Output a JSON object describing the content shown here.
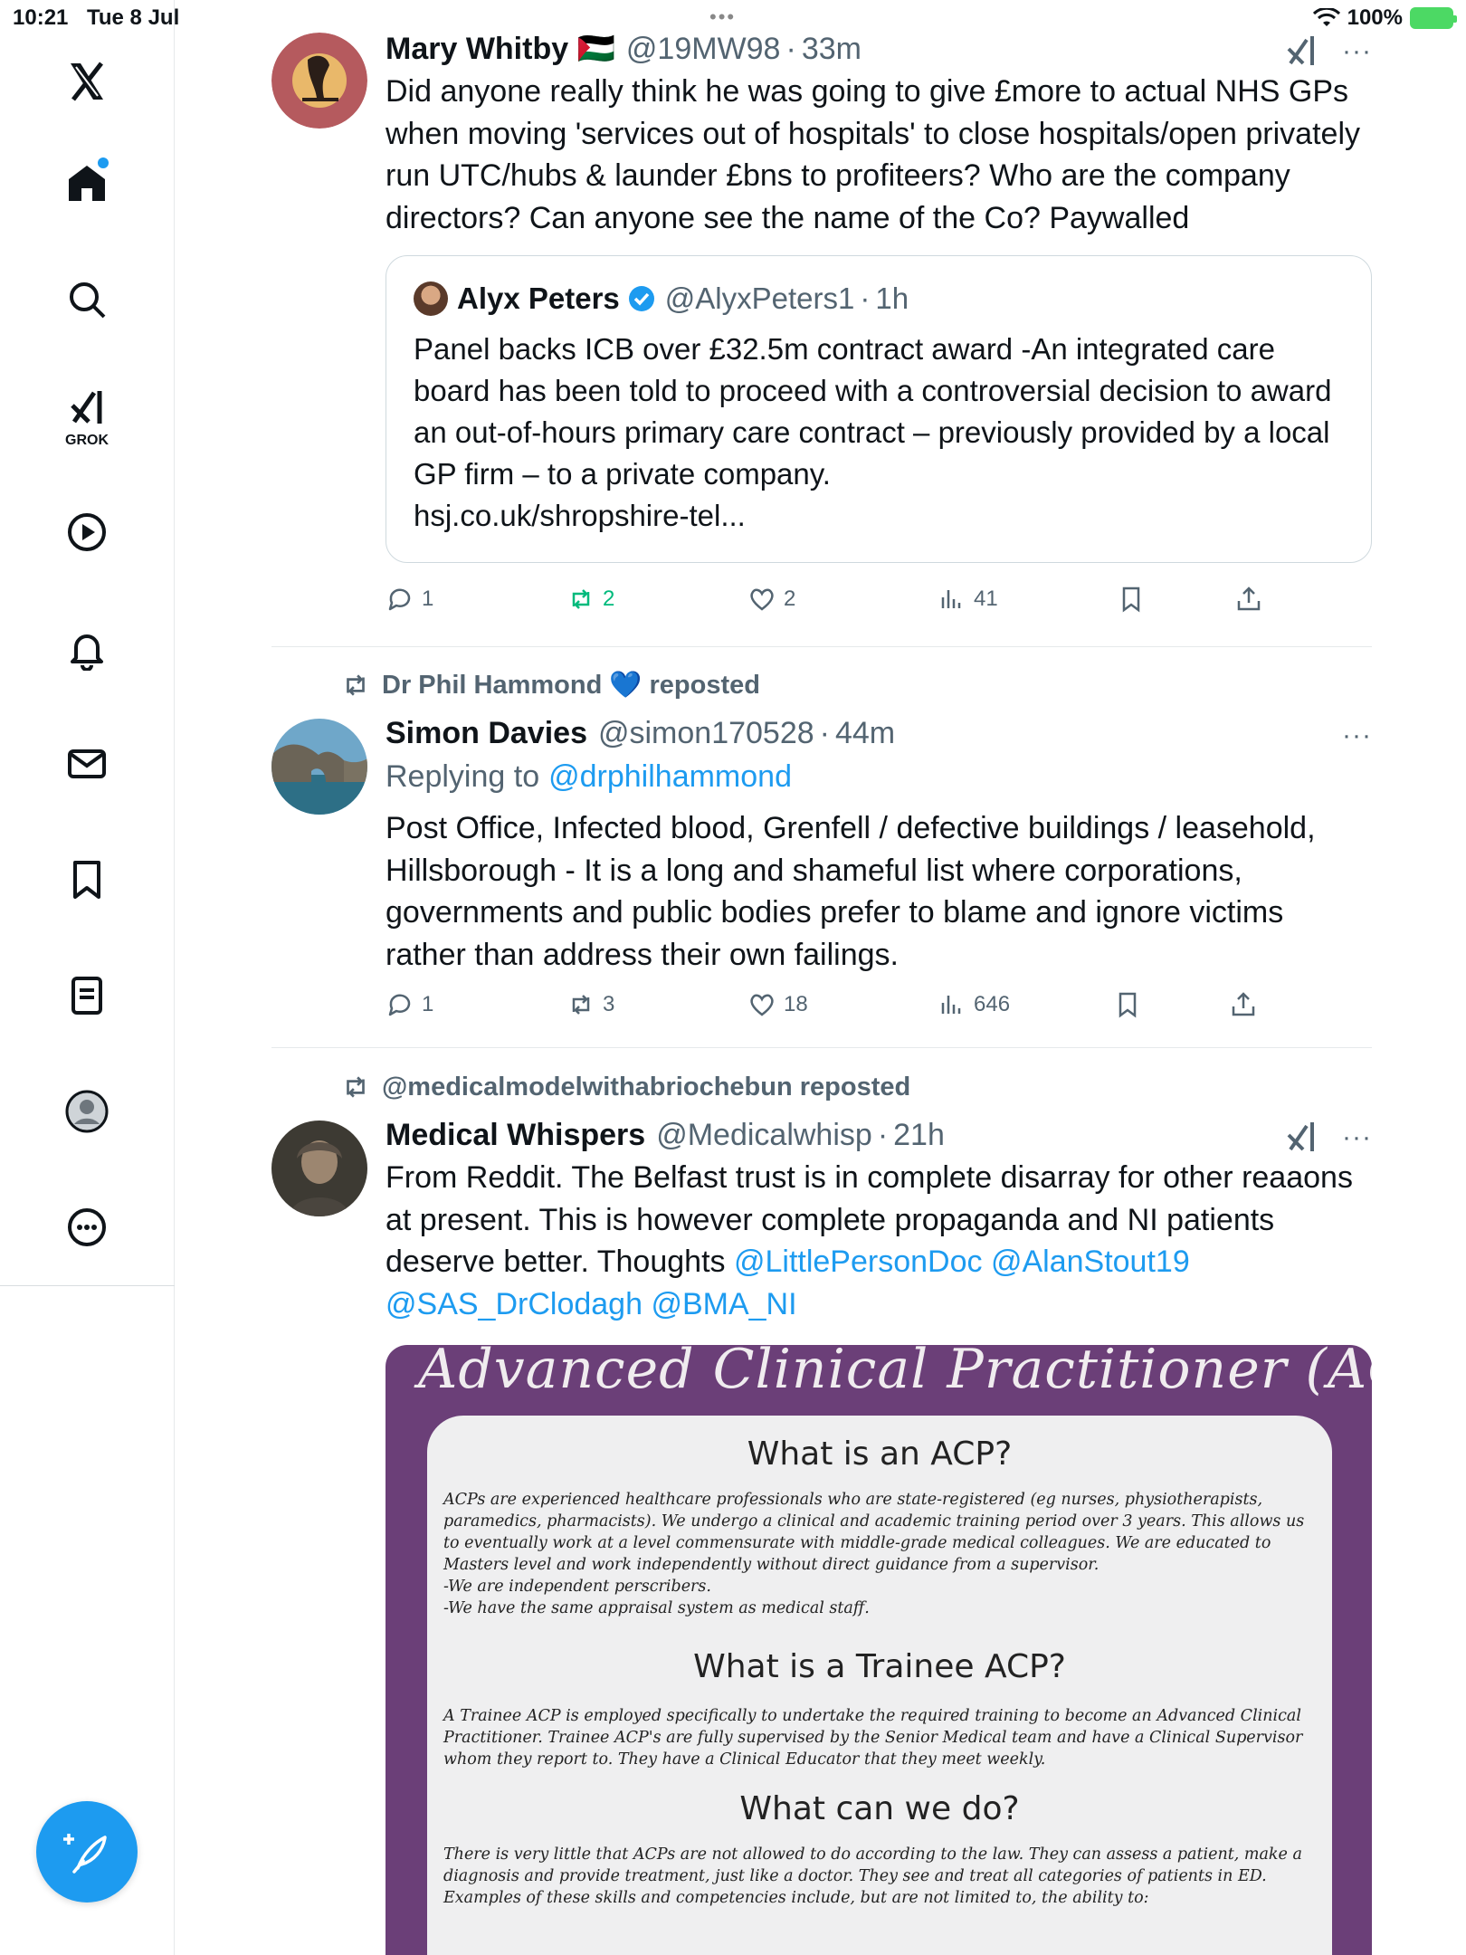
{
  "status_bar": {
    "time": "10:21",
    "date": "Tue 8 Jul",
    "battery": "100%"
  },
  "sidebar": {
    "items": [
      {
        "name": "home"
      },
      {
        "name": "search"
      },
      {
        "name": "grok",
        "label": "GROK"
      },
      {
        "name": "video"
      },
      {
        "name": "notifications"
      },
      {
        "name": "messages"
      },
      {
        "name": "bookmarks"
      },
      {
        "name": "lists"
      },
      {
        "name": "profile"
      },
      {
        "name": "more"
      }
    ]
  },
  "posts": [
    {
      "name": "Mary Whitby 🇵🇸",
      "handle": "@19MW98",
      "time": "33m",
      "text": "Did anyone really think he was going to give £more to actual NHS GPs when moving 'services out of hospitals' to close hospitals/open privately run UTC/hubs & launder £bns to profiteers? Who are the company directors? Can anyone see the name of the Co? Paywalled",
      "quote": {
        "name": "Alyx Peters",
        "handle": "@AlyxPeters1",
        "time": "1h",
        "text": "Panel backs ICB over £32.5m contract award -An integrated care board has been told to proceed with a controversial decision to award an out-of-hours primary care contract – previously provided by a local GP firm – to a private company.",
        "link": "hsj.co.uk/shropshire-tel..."
      },
      "stats": {
        "replies": "1",
        "reposts": "2",
        "likes": "2",
        "views": "41"
      }
    },
    {
      "reposted_by": "Dr Phil Hammond 💙 reposted",
      "name": "Simon Davies",
      "handle": "@simon170528",
      "time": "44m",
      "replying_label": "Replying to",
      "replying_to": "@drphilhammond",
      "text": "Post Office, Infected blood, Grenfell / defective buildings / leasehold, Hillsborough - It is a long and shameful list where corporations, governments and public bodies prefer to blame and ignore victims rather than address their own failings.",
      "stats": {
        "replies": "1",
        "reposts": "3",
        "likes": "18",
        "views": "646"
      }
    },
    {
      "reposted_by": "@medicalmodelwithabriochebun reposted",
      "name": "Medical Whispers",
      "handle": "@Medicalwhisp",
      "time": "21h",
      "text_main": "From Reddit. The Belfast trust is in complete disarray for other reaaons at present. This is however complete propaganda and NI patients deserve better. Thoughts ",
      "mentions": [
        "@LittlePersonDoc",
        "@AlanStout19",
        "@SAS_DrClodagh",
        "@BMA_NI"
      ],
      "image": {
        "title": "Advanced Clinical Practitioner (ACP)",
        "h1": "What is an ACP?",
        "p1": "ACPs are experienced healthcare professionals who are state-registered (eg nurses, physiotherapists, paramedics, pharmacists). We undergo a clinical and academic training period over 3 years. This allows us to eventually work at a level commensurate with middle-grade medical colleagues. We are educated to Masters level and work independently without direct guidance from a supervisor.",
        "p1b": "-We are independent perscribers.",
        "p1c": "-We have the same appraisal system as medical staff.",
        "h2": "What is a Trainee ACP?",
        "p2": "A Trainee ACP is employed specifically to undertake the required training to become an Advanced Clinical Practitioner. Trainee ACP's are fully supervised by the Senior Medical team and have a Clinical Supervisor whom they report to. They have a Clinical Educator that they meet weekly.",
        "h3": "What can we do?",
        "p3": "There is very little that ACPs are not allowed to do according to the law. They can assess a patient, make a diagnosis and provide treatment, just like a doctor. They see and treat all categories of patients in ED. Examples of these skills and competencies include, but are not limited to, the ability to:"
      }
    }
  ]
}
